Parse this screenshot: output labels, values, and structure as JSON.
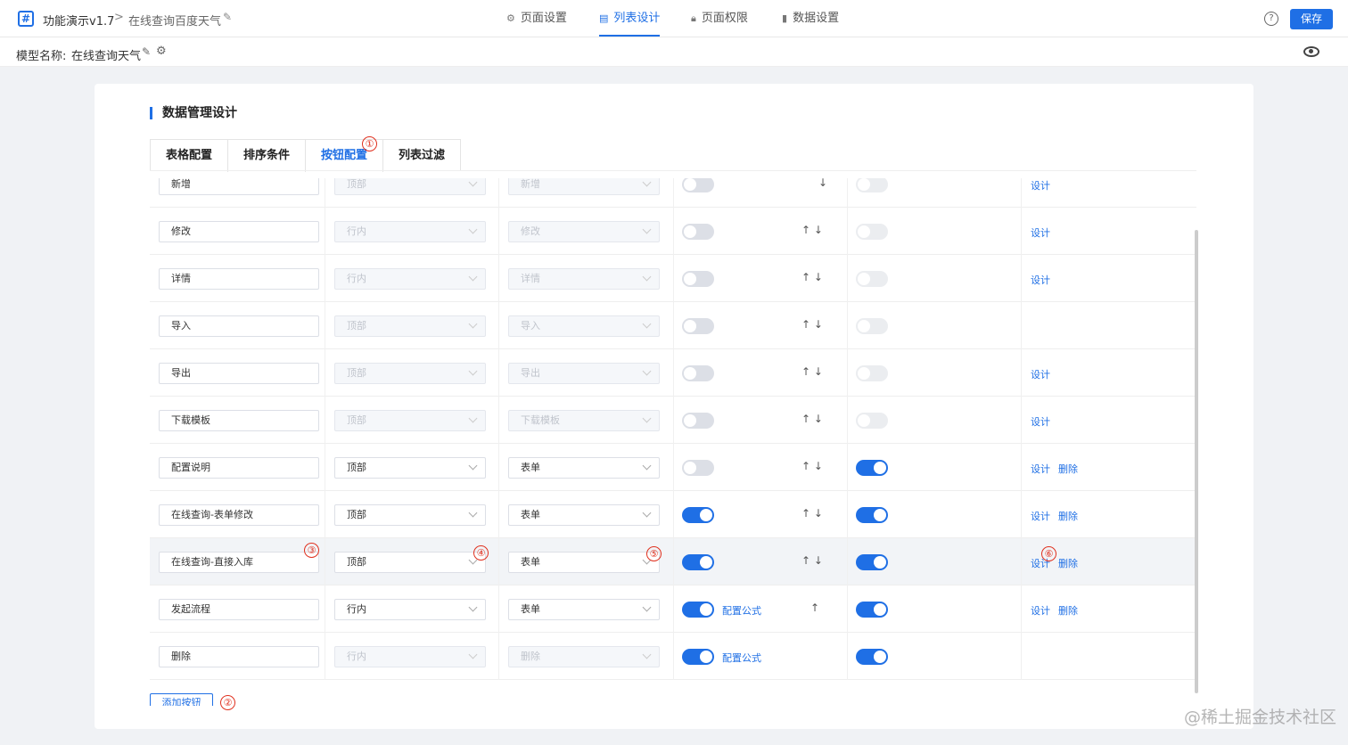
{
  "header": {
    "logo_glyph": "#",
    "app_title": "功能演示v1.7",
    "crumb_sep": ">",
    "crumb_page": "在线查询百度天气",
    "nav": [
      {
        "label": "页面设置",
        "icon": "gear-icon"
      },
      {
        "label": "列表设计",
        "icon": "list-icon",
        "active": true
      },
      {
        "label": "页面权限",
        "icon": "lock-icon"
      },
      {
        "label": "数据设置",
        "icon": "bar-chart-icon"
      }
    ],
    "help_glyph": "?",
    "save_label": "保存"
  },
  "subbar": {
    "model_label": "模型名称:",
    "model_name": "在线查询天气"
  },
  "section_title": "数据管理设计",
  "tabs": [
    "表格配置",
    "排序条件",
    "按钮配置",
    "列表过滤"
  ],
  "active_tab": 2,
  "rows": [
    {
      "name": "新增",
      "position": "顶部",
      "type": "新增",
      "disabled": true,
      "toggle1": false,
      "formula": "",
      "arrows": "↓",
      "toggle2": false,
      "toggle2_disabled": true,
      "actions": [
        "设计"
      ]
    },
    {
      "name": "修改",
      "position": "行内",
      "type": "修改",
      "disabled": true,
      "toggle1": false,
      "formula": "",
      "arrows": "↑ ↓",
      "toggle2": false,
      "toggle2_disabled": true,
      "actions": [
        "设计"
      ]
    },
    {
      "name": "详情",
      "position": "行内",
      "type": "详情",
      "disabled": true,
      "toggle1": false,
      "formula": "",
      "arrows": "↑ ↓",
      "toggle2": false,
      "toggle2_disabled": true,
      "actions": [
        "设计"
      ]
    },
    {
      "name": "导入",
      "position": "顶部",
      "type": "导入",
      "disabled": true,
      "toggle1": false,
      "formula": "",
      "arrows": "↑ ↓",
      "toggle2": false,
      "toggle2_disabled": true,
      "actions": []
    },
    {
      "name": "导出",
      "position": "顶部",
      "type": "导出",
      "disabled": true,
      "toggle1": false,
      "formula": "",
      "arrows": "↑ ↓",
      "toggle2": false,
      "toggle2_disabled": true,
      "actions": [
        "设计"
      ]
    },
    {
      "name": "下载模板",
      "position": "顶部",
      "type": "下载模板",
      "disabled": true,
      "toggle1": false,
      "formula": "",
      "arrows": "↑ ↓",
      "toggle2": false,
      "toggle2_disabled": true,
      "actions": [
        "设计"
      ]
    },
    {
      "name": "配置说明",
      "position": "顶部",
      "type": "表单",
      "disabled": false,
      "toggle1": false,
      "formula": "",
      "arrows": "↑ ↓",
      "toggle2": true,
      "toggle2_disabled": false,
      "actions": [
        "设计",
        "删除"
      ]
    },
    {
      "name": "在线查询-表单修改",
      "position": "顶部",
      "type": "表单",
      "disabled": false,
      "toggle1": true,
      "formula": "",
      "arrows": "↑ ↓",
      "toggle2": true,
      "toggle2_disabled": false,
      "actions": [
        "设计",
        "删除"
      ]
    },
    {
      "name": "在线查询-直接入库",
      "position": "顶部",
      "type": "表单",
      "disabled": false,
      "toggle1": true,
      "formula": "",
      "arrows": "↑ ↓",
      "toggle2": true,
      "toggle2_disabled": false,
      "actions": [
        "设计",
        "删除"
      ],
      "highlight": true
    },
    {
      "name": "发起流程",
      "position": "行内",
      "type": "表单",
      "disabled": false,
      "toggle1": true,
      "formula": "配置公式",
      "arrows": "↑",
      "toggle2": true,
      "toggle2_disabled": false,
      "actions": [
        "设计",
        "删除"
      ]
    },
    {
      "name": "删除",
      "position": "行内",
      "type": "删除",
      "disabled": true,
      "toggle1": true,
      "formula": "配置公式",
      "arrows": "",
      "toggle2": true,
      "toggle2_disabled": false,
      "actions": []
    }
  ],
  "add_button_label": "添加按钮",
  "markers": [
    "①",
    "②",
    "③",
    "④",
    "⑤",
    "⑥"
  ],
  "watermark": "@稀土掘金技术社区",
  "colors": {
    "accent": "#1f6fe5",
    "marker": "#e0301e",
    "background": "#f0f2f5"
  }
}
